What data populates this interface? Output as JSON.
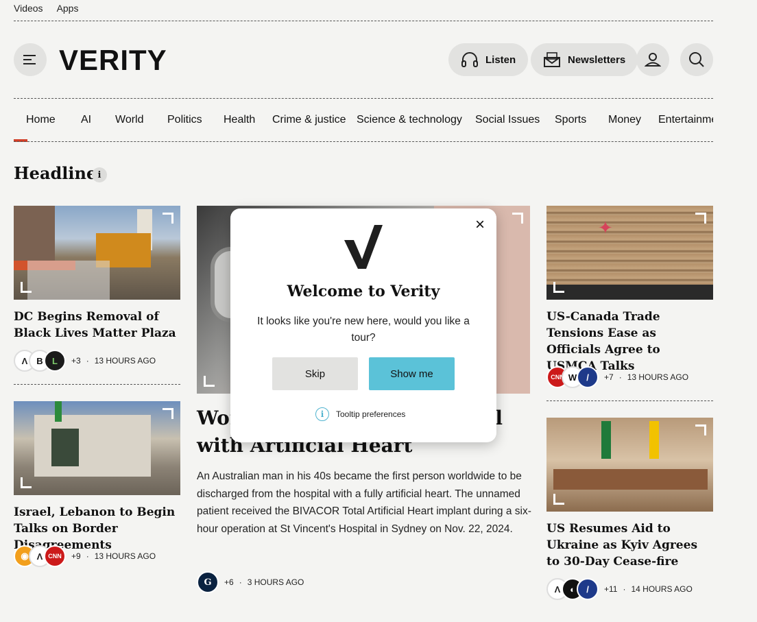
{
  "top_links": [
    "Videos",
    "Apps"
  ],
  "header": {
    "logo": "VERITY",
    "listen": "Listen",
    "newsletters": "Newsletters"
  },
  "nav": [
    "Home",
    "AI",
    "World",
    "Politics",
    "Health",
    "Crime & justice",
    "Science & technology",
    "Social Issues",
    "Sports",
    "Money",
    "Entertainment"
  ],
  "section_title": "Headlines",
  "info_glyph": "i",
  "cards": {
    "c1": {
      "title": "DC Begins Removal of Black Lives Matter Plaza",
      "more": "+3",
      "time": "13 HOURS AGO"
    },
    "c2": {
      "title": "Israel, Lebanon to Begin Talks on Border Disagreements",
      "more": "+9",
      "time": "13 HOURS AGO"
    },
    "c3": {
      "title": "US-Canada Trade Tensions Ease as Officials Agree to USMCA Talks",
      "more": "+7",
      "time": "13 HOURS AGO"
    },
    "c4": {
      "title": "US Resumes Aid to Ukraine as Kyiv Agrees to 30-Day Cease-fire",
      "more": "+11",
      "time": "14 HOURS AGO"
    },
    "main": {
      "title_line1": "Wor",
      "title_line1_end": "l",
      "title_line2": "with Artificial Heart",
      "desc": "An Australian man in his 40s became the first person worldwide to be discharged from the hospital with a fully artificial heart. The unnamed patient received the BIVACOR Total Artificial Heart implant during a six-hour operation at St Vincent's Hospital in Sydney on Nov. 22, 2024.",
      "more": "+6",
      "time": "3 HOURS AGO"
    }
  },
  "modal": {
    "title": "Welcome to Verity",
    "text": "It looks like you're new here, would you like a tour?",
    "skip": "Skip",
    "show": "Show me",
    "prefs": "Tooltip preferences",
    "close": "×"
  },
  "colors": {
    "accent": "#d0402a",
    "show_button": "#5bc2d8",
    "background": "#f4f4f2"
  }
}
